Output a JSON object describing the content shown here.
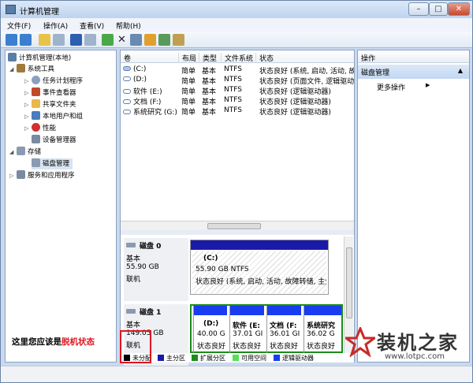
{
  "window": {
    "title": "计算机管理"
  },
  "menu": [
    "文件(F)",
    "操作(A)",
    "查看(V)",
    "帮助(H)"
  ],
  "tree": {
    "root": "计算机管理(本地)",
    "system_tools": "系统工具",
    "items": [
      "任务计划程序",
      "事件查看器",
      "共享文件夹",
      "本地用户和组",
      "性能",
      "设备管理器"
    ],
    "storage": "存储",
    "disk_mgmt": "磁盘管理",
    "services": "服务和应用程序"
  },
  "volume_table": {
    "headers": [
      "卷",
      "布局",
      "类型",
      "文件系统",
      "状态"
    ],
    "rows": [
      [
        "(C:)",
        "简单",
        "基本",
        "NTFS",
        "状态良好 (系统, 启动, 活动, 故"
      ],
      [
        "(D:)",
        "简单",
        "基本",
        "NTFS",
        "状态良好 (页面文件, 逻辑驱动器"
      ],
      [
        "软件 (E:)",
        "简单",
        "基本",
        "NTFS",
        "状态良好 (逻辑驱动器)"
      ],
      [
        "文档 (F:)",
        "简单",
        "基本",
        "NTFS",
        "状态良好 (逻辑驱动器)"
      ],
      [
        "系统研究 (G:)",
        "简单",
        "基本",
        "NTFS",
        "状态良好 (逻辑驱动器)"
      ]
    ]
  },
  "disks": [
    {
      "name": "磁盘 0",
      "type": "基本",
      "size": "55.90 GB",
      "state": "联机",
      "partitions": [
        {
          "label": "(C:)",
          "size": "55.90 GB NTFS",
          "status": "状态良好 (系统, 启动, 活动, 故障转储, 主分"
        }
      ]
    },
    {
      "name": "磁盘 1",
      "type": "基本",
      "size": "149.05 GB",
      "state": "联机",
      "partitions": [
        {
          "label": "(D:)",
          "size": "40.00 G",
          "status": "状态良好"
        },
        {
          "label": "软件 (E:",
          "size": "37.01 GI",
          "status": "状态良好"
        },
        {
          "label": "文档 (F:",
          "size": "36.01 GI",
          "status": "状态良好"
        },
        {
          "label": "系统研究",
          "size": "36.02 G",
          "status": "状态良好"
        }
      ]
    }
  ],
  "legend": [
    {
      "label": "未分配",
      "color": "#000000"
    },
    {
      "label": "主分区",
      "color": "#1a1aa8"
    },
    {
      "label": "扩展分区",
      "color": "#1a8c1a"
    },
    {
      "label": "可用空间",
      "color": "#55e055"
    },
    {
      "label": "逻辑驱动器",
      "color": "#1a3cf0"
    }
  ],
  "actions": {
    "header": "操作",
    "selected": "磁盘管理",
    "more": "更多操作"
  },
  "annotation": {
    "prefix": "这里您应该是",
    "highlight": "脱机状态"
  },
  "watermark": {
    "brand": "装机之家",
    "url": "www.lotpc.com"
  }
}
